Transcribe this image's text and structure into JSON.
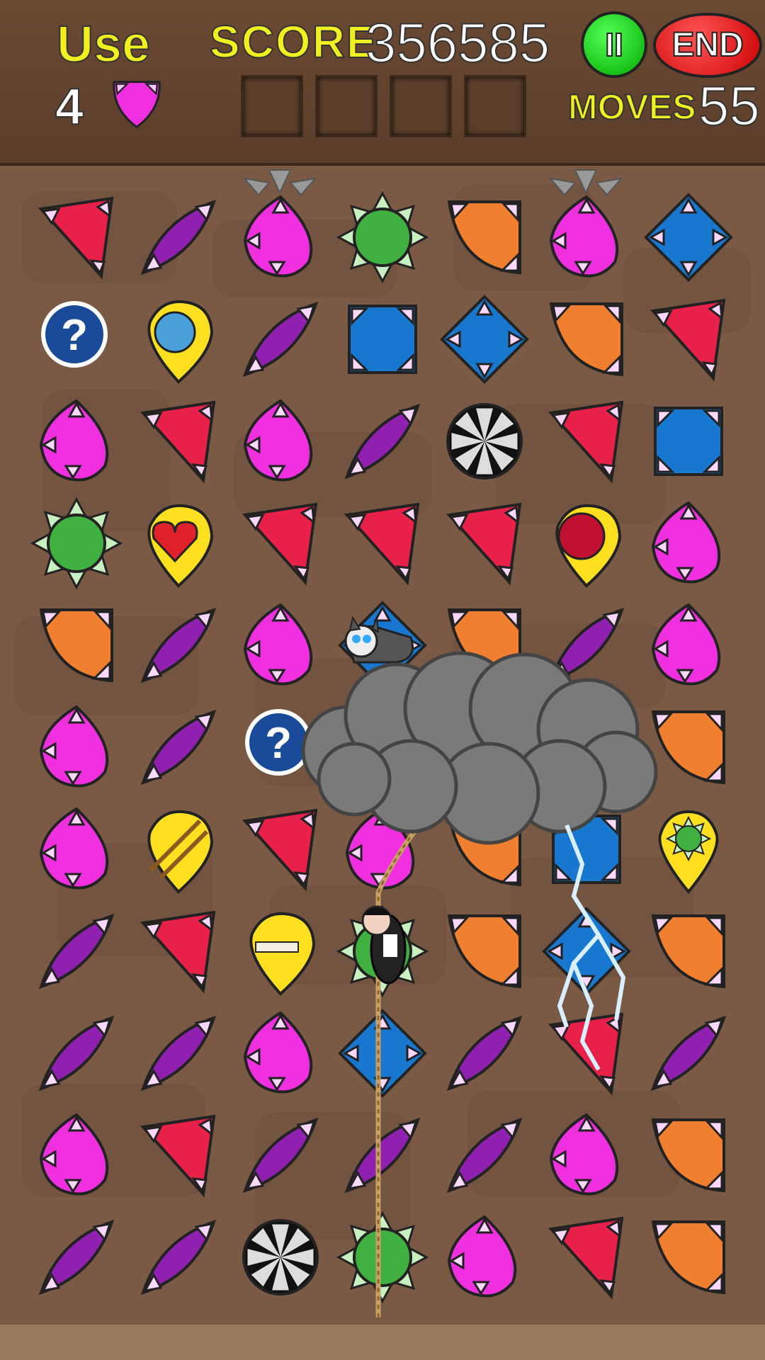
{
  "hud": {
    "use_label": "Use",
    "use_count": "4",
    "use_gem": "magenta-gem",
    "score_label": "SCORE",
    "score_value": "356585",
    "pause_label": "II",
    "end_label": "END",
    "moves_label": "MOVES",
    "moves_value": "55"
  },
  "colors": {
    "red": "#e8204a",
    "purple": "#9020b0",
    "magenta": "#f030e0",
    "green": "#40b040",
    "orange": "#f08030",
    "blue": "#1878d0",
    "yellow": "#ffe020"
  },
  "board": {
    "rows": [
      [
        "red-triangle",
        "purple-leaf",
        "magenta-drop",
        "green-star",
        "orange-quarter",
        "magenta-drop",
        "blue-diamond"
      ],
      [
        "hint-bubble",
        "fan-powerup",
        "purple-leaf",
        "blue-square",
        "blue-diamond",
        "orange-quarter",
        "red-triangle"
      ],
      [
        "magenta-drop",
        "red-triangle",
        "magenta-drop",
        "purple-leaf",
        "black-wheel",
        "red-triangle",
        "blue-square"
      ],
      [
        "green-star",
        "heart-powerup",
        "red-triangle",
        "red-triangle",
        "red-triangle",
        "bonus-powerup",
        "magenta-drop"
      ],
      [
        "orange-quarter",
        "purple-leaf",
        "magenta-drop",
        "blue-diamond",
        "orange-quarter",
        "purple-leaf",
        "magenta-drop"
      ],
      [
        "magenta-drop",
        "purple-leaf",
        "hint-bubble",
        "",
        "",
        "",
        "orange-quarter"
      ],
      [
        "magenta-drop",
        "ladder-powerup",
        "red-triangle",
        "magenta-drop",
        "orange-quarter",
        "blue-square",
        "green-star-pin"
      ],
      [
        "purple-leaf",
        "red-triangle",
        "bone-powerup",
        "green-star",
        "orange-quarter",
        "blue-diamond",
        "orange-quarter"
      ],
      [
        "purple-leaf",
        "purple-leaf",
        "magenta-drop",
        "blue-diamond",
        "purple-leaf",
        "red-triangle",
        "purple-leaf"
      ],
      [
        "magenta-drop",
        "red-triangle",
        "purple-leaf",
        "purple-leaf",
        "purple-leaf",
        "magenta-drop",
        "orange-quarter"
      ],
      [
        "purple-leaf",
        "purple-leaf",
        "black-wheel",
        "green-star",
        "magenta-drop",
        "red-triangle",
        "orange-quarter"
      ]
    ],
    "characters": [
      "husky-dog",
      "vampire-climber"
    ],
    "effects": [
      "storm-cloud",
      "lightning-bolt",
      "rope"
    ],
    "drop_arrows": [
      "drop-arrow-col-3",
      "drop-arrow-col-6"
    ]
  }
}
